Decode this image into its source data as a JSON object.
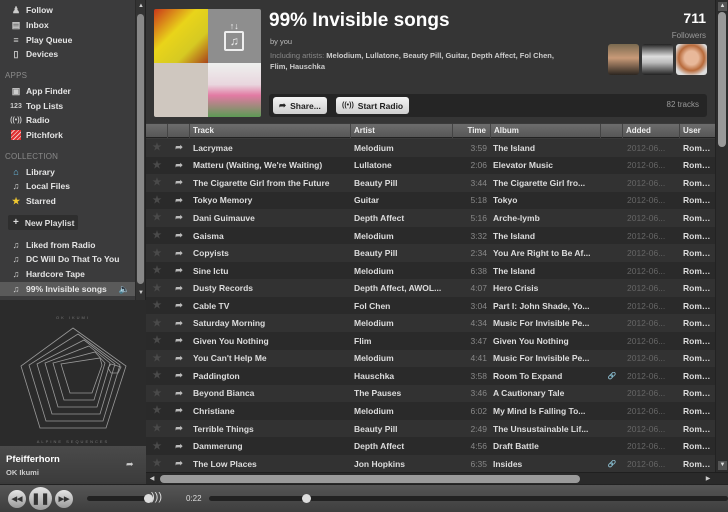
{
  "sidebar": {
    "main_items": [
      {
        "label": "Follow",
        "icon": "follow-icon"
      },
      {
        "label": "Inbox",
        "icon": "inbox-icon"
      },
      {
        "label": "Play Queue",
        "icon": "queue-icon"
      },
      {
        "label": "Devices",
        "icon": "devices-icon"
      }
    ],
    "apps_heading": "APPS",
    "apps": [
      {
        "label": "App Finder",
        "icon": "app-finder-icon"
      },
      {
        "label": "Top Lists",
        "icon": "top-lists-icon"
      },
      {
        "label": "Radio",
        "icon": "radio-icon"
      },
      {
        "label": "Pitchfork",
        "icon": "pitchfork-icon"
      }
    ],
    "collection_heading": "COLLECTION",
    "collection": [
      {
        "label": "Library",
        "icon": "library-icon"
      },
      {
        "label": "Local Files",
        "icon": "local-files-icon"
      },
      {
        "label": "Starred",
        "icon": "star-icon"
      }
    ],
    "new_playlist_label": "New Playlist",
    "playlists": [
      {
        "label": "Liked from Radio"
      },
      {
        "label": "DC Will Do That To You"
      },
      {
        "label": "Hardcore Tape"
      },
      {
        "label": "99% Invisible songs",
        "active": true,
        "playing": true
      }
    ]
  },
  "now_playing": {
    "album_art_top_text": "OK IKUMI",
    "album_art_bottom_text": "ALPINE SEQUENCES",
    "title": "Pfeifferhorn",
    "artist": "OK Ikumi"
  },
  "playlist": {
    "title": "99% Invisible songs",
    "by": "by you",
    "including_prefix": "Including artists:",
    "including_artists": "Melodium, Lullatone, Beauty Pill, Guitar, Depth Affect, Fol Chen, Flim, Hauschka",
    "followers_count": "711",
    "followers_label": "Followers",
    "share_label": "Share...",
    "radio_label": "Start Radio",
    "tracks_count": "82 tracks"
  },
  "table": {
    "columns": [
      "",
      "",
      "Track",
      "Artist",
      "Time",
      "Album",
      "",
      "Added",
      "User"
    ],
    "rows": [
      {
        "track": "Lacrymae",
        "artist": "Melodium",
        "time": "3:59",
        "album": "The Island",
        "link": false,
        "added": "2012-06...",
        "user": "Roman M"
      },
      {
        "track": "Matteru (Waiting, We're Waiting)",
        "artist": "Lullatone",
        "time": "2:06",
        "album": "Elevator Music",
        "link": false,
        "added": "2012-06...",
        "user": "Roman M"
      },
      {
        "track": "The Cigarette Girl from the Future",
        "artist": "Beauty Pill",
        "time": "3:44",
        "album": "The Cigarette Girl fro...",
        "link": false,
        "added": "2012-06...",
        "user": "Roman M"
      },
      {
        "track": "Tokyo Memory",
        "artist": "Guitar",
        "time": "5:18",
        "album": "Tokyo",
        "link": false,
        "added": "2012-06...",
        "user": "Roman M"
      },
      {
        "track": "Dani Guimauve",
        "artist": "Depth Affect",
        "time": "5:16",
        "album": "Arche-lymb",
        "link": false,
        "added": "2012-06...",
        "user": "Roman M"
      },
      {
        "track": "Gaisma",
        "artist": "Melodium",
        "time": "3:32",
        "album": "The Island",
        "link": false,
        "added": "2012-06...",
        "user": "Roman M"
      },
      {
        "track": "Copyists",
        "artist": "Beauty Pill",
        "time": "2:34",
        "album": "You Are Right to Be Af...",
        "link": false,
        "added": "2012-06...",
        "user": "Roman M"
      },
      {
        "track": "Sine Ictu",
        "artist": "Melodium",
        "time": "6:38",
        "album": "The Island",
        "link": false,
        "added": "2012-06...",
        "user": "Roman M"
      },
      {
        "track": "Dusty Records",
        "artist": "Depth Affect, AWOL...",
        "time": "4:07",
        "album": "Hero Crisis",
        "link": false,
        "added": "2012-06...",
        "user": "Roman M"
      },
      {
        "track": "Cable TV",
        "artist": "Fol Chen",
        "time": "3:04",
        "album": "Part I: John Shade, Yo...",
        "link": false,
        "added": "2012-06...",
        "user": "Roman M"
      },
      {
        "track": "Saturday Morning",
        "artist": "Melodium",
        "time": "4:34",
        "album": "Music For Invisible Pe...",
        "link": false,
        "added": "2012-06...",
        "user": "Roman M"
      },
      {
        "track": "Given You Nothing",
        "artist": "Flim",
        "time": "3:47",
        "album": "Given You Nothing",
        "link": false,
        "added": "2012-06...",
        "user": "Roman M"
      },
      {
        "track": "You Can't Help Me",
        "artist": "Melodium",
        "time": "4:41",
        "album": "Music For Invisible Pe...",
        "link": false,
        "added": "2012-06...",
        "user": "Roman M"
      },
      {
        "track": "Paddington",
        "artist": "Hauschka",
        "time": "3:58",
        "album": "Room To Expand",
        "link": true,
        "added": "2012-06...",
        "user": "Roman M"
      },
      {
        "track": "Beyond Bianca",
        "artist": "The Pauses",
        "time": "3:46",
        "album": "A Cautionary Tale",
        "link": false,
        "added": "2012-06...",
        "user": "Roman M"
      },
      {
        "track": "Christiane",
        "artist": "Melodium",
        "time": "6:02",
        "album": "My Mind Is Falling To...",
        "link": false,
        "added": "2012-06...",
        "user": "Roman M"
      },
      {
        "track": "Terrible Things",
        "artist": "Beauty Pill",
        "time": "2:49",
        "album": "The Unsustainable Lif...",
        "link": false,
        "added": "2012-06...",
        "user": "Roman M"
      },
      {
        "track": "Dammerung",
        "artist": "Depth Affect",
        "time": "4:56",
        "album": "Draft Battle",
        "link": false,
        "added": "2012-06...",
        "user": "Roman M"
      },
      {
        "track": "The Low Places",
        "artist": "Jon Hopkins",
        "time": "6:35",
        "album": "Insides",
        "link": true,
        "added": "2012-06...",
        "user": "Roman M"
      }
    ]
  },
  "player": {
    "elapsed": "0:22",
    "volume_fraction": 1.0,
    "seek_fraction": 0.18
  }
}
